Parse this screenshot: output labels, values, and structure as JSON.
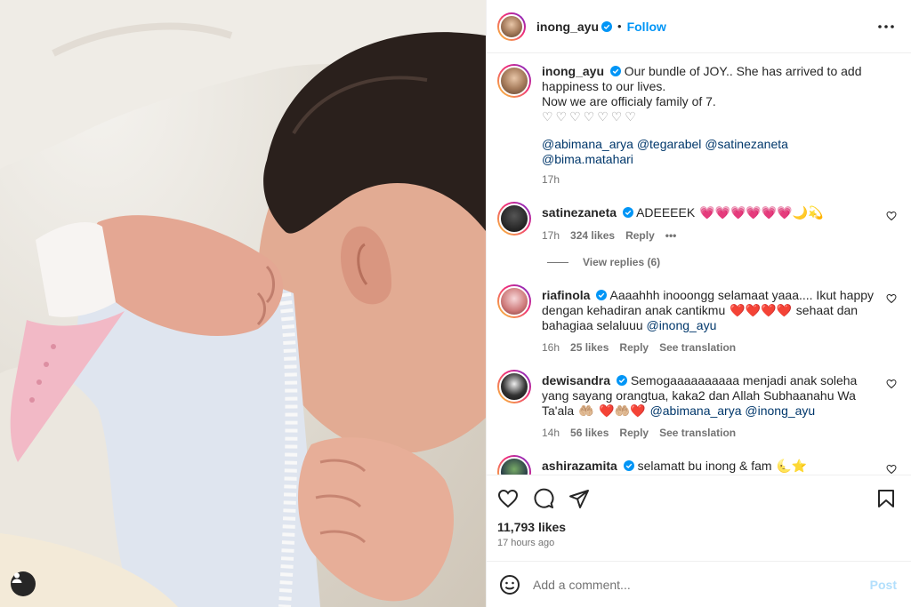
{
  "post": {
    "author": "inong_ayu",
    "follow_label": "Follow",
    "separator": "•"
  },
  "caption": {
    "username": "inong_ayu",
    "text": "Our bundle of JOY.. She has arrived to add happiness to our lives.",
    "text2": "Now we are officialy family of 7.",
    "hearts": "♡♡♡♡♡♡♡",
    "mentions": [
      "@abimana_arya",
      "@tegarabel",
      "@satinezaneta",
      "@bima.matahari"
    ],
    "time": "17h"
  },
  "comments": [
    {
      "username": "satinezaneta",
      "text": "ADEEEEK",
      "emoji": "💗💗💗💗💗💗🌙💫",
      "time": "17h",
      "likes": "324 likes",
      "reply": "Reply",
      "more": "•••",
      "view_replies": "View replies (6)"
    },
    {
      "username": "riafinola",
      "text": "Aaaahhh inooongg selamaat yaaa.... Ikut happy dengan kehadiran anak cantikmu",
      "hearts": "❤️❤️❤️❤️",
      "text_after": "sehaat dan bahagiaa selaluuu",
      "mention": "@inong_ayu",
      "time": "16h",
      "likes": "25 likes",
      "reply": "Reply",
      "translate": "See translation"
    },
    {
      "username": "dewisandra",
      "text": "Semogaaaaaaaaaa menjadi anak soleha yang sayang orangtua, kaka2 dan Allah Subhaanahu Wa Ta'ala",
      "emoji1": "🤲🏼",
      "emoji2": "❤️🤲🏼❤️",
      "mentions": [
        "@abimana_arya",
        "@inong_ayu"
      ],
      "time": "14h",
      "likes": "56 likes",
      "reply": "Reply",
      "translate": "See translation"
    },
    {
      "username": "ashirazamita",
      "text": "selamatt bu inong & fam",
      "emoji": "🌜⭐"
    }
  ],
  "stats": {
    "likes": "11,793 likes",
    "time": "17 hours ago"
  },
  "composer": {
    "placeholder": "Add a comment...",
    "post_label": "Post"
  },
  "icons": {
    "more": "more-horizontal-icon",
    "like": "heart-icon",
    "comment": "comment-icon",
    "share": "share-icon",
    "save": "bookmark-icon",
    "emoji": "smile-icon",
    "user_tag": "user-tag-icon",
    "verified": "verified-badge-icon"
  },
  "colors": {
    "accent": "#0095f6",
    "verified": "#0095f6",
    "muted": "#737373",
    "mention": "#00376b"
  }
}
